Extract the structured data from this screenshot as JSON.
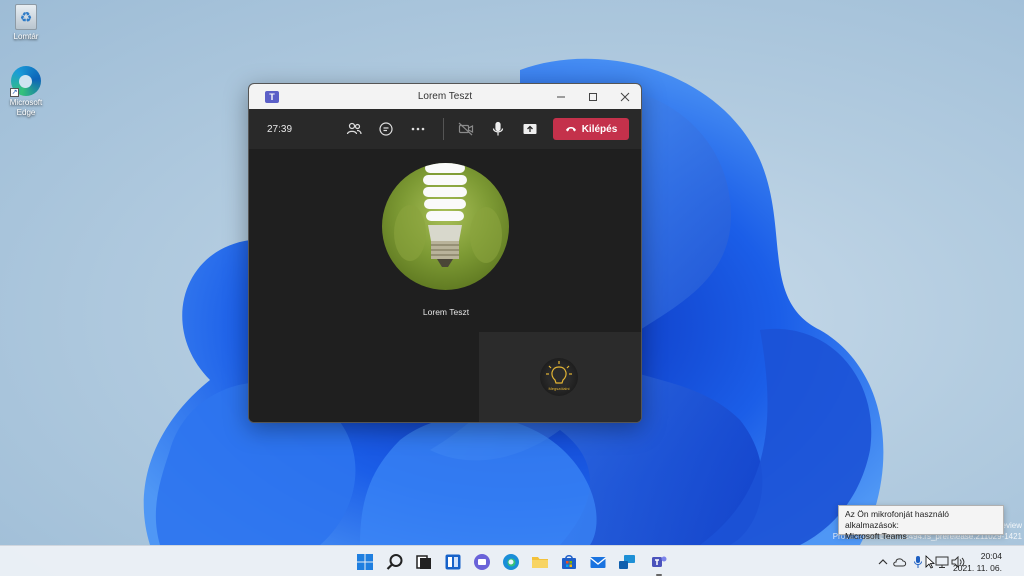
{
  "desktop": {
    "icons": [
      {
        "label": "Lomtár"
      },
      {
        "label": "Microsoft Edge"
      }
    ]
  },
  "window": {
    "title": "Lorem Teszt",
    "timer": "27:39",
    "leave_label": "Kilépés",
    "caller_name": "Lorem Teszt",
    "self_avatar_text": "Megszólalni"
  },
  "tooltip": {
    "line1": "Az Ön mikrofonját használó alkalmazások:",
    "line2": "Microsoft Teams"
  },
  "watermark": {
    "line1": "eview",
    "line2": "Próbaverzió. Build 22494.rs_prerelease.211029-1421"
  },
  "clock": {
    "time": "20:04",
    "date": "2021. 11. 06."
  },
  "colors": {
    "leave": "#c4314b",
    "teams": "#5b5fc7"
  }
}
